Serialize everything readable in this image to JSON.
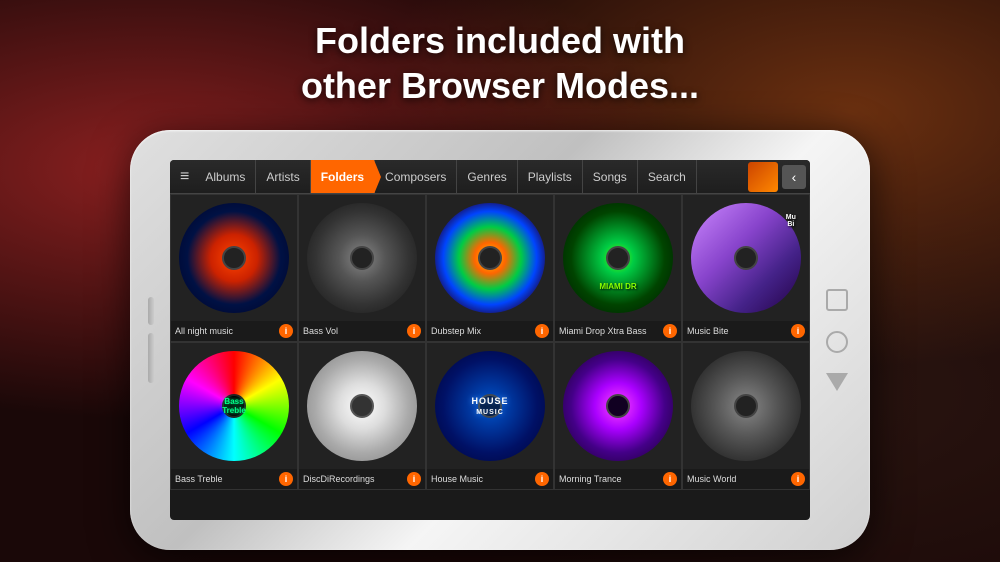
{
  "headline": {
    "line1": "Folders included with",
    "line2": "other Browser Modes..."
  },
  "tabs": [
    {
      "label": "Albums",
      "active": false
    },
    {
      "label": "Artists",
      "active": false
    },
    {
      "label": "Folders",
      "active": true
    },
    {
      "label": "Composers",
      "active": false
    },
    {
      "label": "Genres",
      "active": false
    },
    {
      "label": "Playlists",
      "active": false
    },
    {
      "label": "Songs",
      "active": false
    },
    {
      "label": "Search",
      "active": false
    }
  ],
  "folders": [
    {
      "name": "All night music",
      "disc": "fireworks"
    },
    {
      "name": "Bass Vol",
      "disc": "speaker"
    },
    {
      "name": "Dubstep Mix",
      "disc": "colorpad"
    },
    {
      "name": "Miami Drop Xtra Bass",
      "disc": "miami"
    },
    {
      "name": "Music Bite",
      "disc": "musicbite"
    },
    {
      "name": "Bass Treble",
      "disc": "basstreble"
    },
    {
      "name": "DiscDiRecordings",
      "disc": "discdi"
    },
    {
      "name": "House Music",
      "disc": "house"
    },
    {
      "name": "Morning Trance",
      "disc": "trance"
    },
    {
      "name": "Music World",
      "disc": "world"
    }
  ],
  "icons": {
    "menu": "≡",
    "back": "‹",
    "info": "i"
  }
}
